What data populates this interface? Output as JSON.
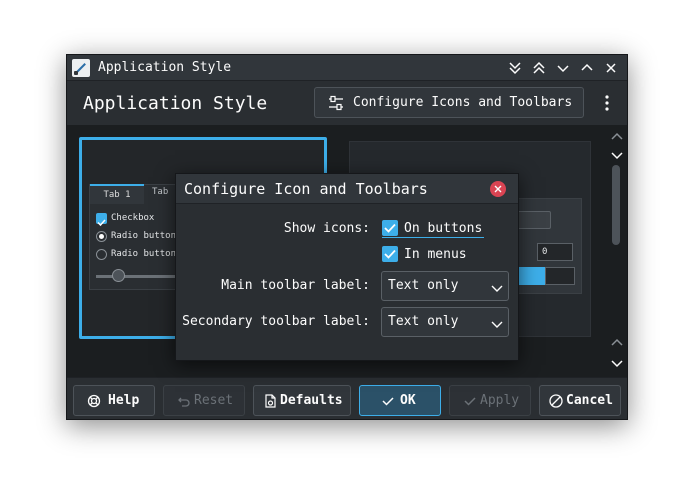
{
  "window": {
    "title": "Application Style",
    "controls": [
      "keep-below",
      "keep-above",
      "minimize",
      "maximize",
      "close"
    ]
  },
  "header": {
    "title": "Application Style",
    "configure_button": "Configure Icons and Toolbars"
  },
  "preview_left": {
    "tabs": [
      "Tab 1",
      "Tab"
    ],
    "checkbox": "Checkbox",
    "radio1": "Radio button",
    "radio2": "Radio button"
  },
  "preview_right": {
    "spin_value": "0"
  },
  "footer": {
    "help": "Help",
    "reset": "Reset",
    "defaults": "Defaults",
    "ok": "OK",
    "apply": "Apply",
    "cancel": "Cancel"
  },
  "dialog": {
    "title": "Configure Icon and Toolbars",
    "show_icons_label": "Show icons:",
    "on_buttons": "On buttons",
    "in_menus": "In menus",
    "main_toolbar_label": "Main toolbar label:",
    "main_toolbar_value": "Text only",
    "secondary_toolbar_label": "Secondary toolbar label:",
    "secondary_toolbar_value": "Text only"
  },
  "colors": {
    "accent": "#3daee9",
    "close": "#da4453",
    "background": "#2a2e32"
  }
}
